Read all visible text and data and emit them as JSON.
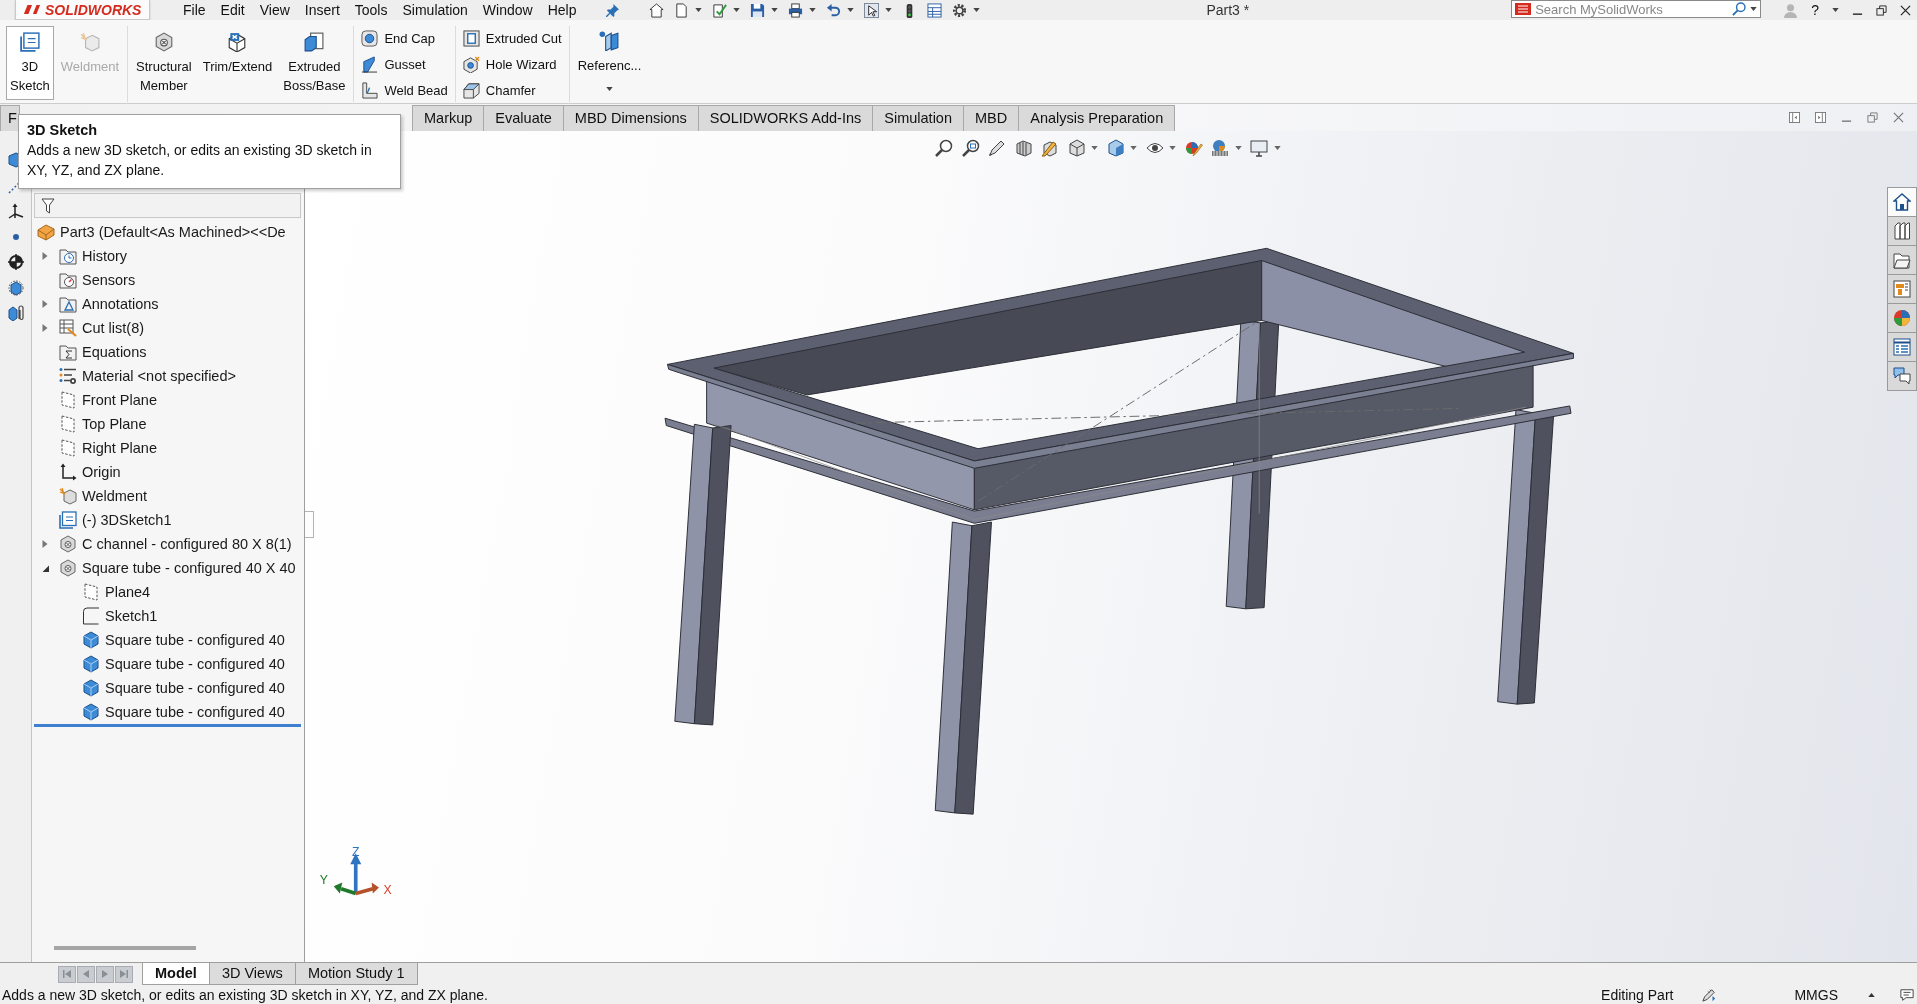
{
  "menu": {
    "logo": "SOLIDWORKS",
    "items": [
      "File",
      "Edit",
      "View",
      "Insert",
      "Tools",
      "Simulation",
      "Window",
      "Help"
    ],
    "help": "?"
  },
  "title": "Part3 *",
  "search": {
    "placeholder": "Search MySolidWorks"
  },
  "command_manager": {
    "large_groups": [
      [
        {
          "lines": [
            "3D",
            "Sketch"
          ],
          "kind": "sketch3d",
          "hovered": true,
          "disabled": false
        },
        {
          "lines": [
            "Weldment"
          ],
          "kind": "weldment",
          "hovered": false,
          "disabled": true
        }
      ],
      [
        {
          "lines": [
            "Structural",
            "Member"
          ],
          "kind": "member",
          "hovered": false,
          "disabled": false
        },
        {
          "lines": [
            "Trim/Extend"
          ],
          "kind": "trim",
          "hovered": false,
          "disabled": false
        },
        {
          "lines": [
            "Extruded",
            "Boss/Base"
          ],
          "kind": "boss",
          "hovered": false,
          "disabled": false
        }
      ]
    ],
    "small_groups": [
      [
        {
          "label": "End Cap",
          "kind": "endcap"
        },
        {
          "label": "Gusset",
          "kind": "gusset"
        },
        {
          "label": "Weld Bead",
          "kind": "weldbead"
        }
      ],
      [
        {
          "label": "Extruded Cut",
          "kind": "cut"
        },
        {
          "label": "Hole Wizard",
          "kind": "hole"
        },
        {
          "label": "Chamfer",
          "kind": "chamfer"
        }
      ]
    ],
    "reference": "Referenc..."
  },
  "tabs": [
    {
      "label": "F",
      "selected": false
    },
    {
      "label": "Markup",
      "selected": false
    },
    {
      "label": "Evaluate",
      "selected": false
    },
    {
      "label": "MBD Dimensions",
      "selected": false
    },
    {
      "label": "SOLIDWORKS Add-Ins",
      "selected": false
    },
    {
      "label": "Simulation",
      "selected": false
    },
    {
      "label": "MBD",
      "selected": false
    },
    {
      "label": "Analysis Preparation",
      "selected": false
    }
  ],
  "tooltip": {
    "title": "3D Sketch",
    "text": "Adds a new 3D sketch, or edits an existing 3D sketch in XY, YZ, and ZX plane."
  },
  "tree": {
    "root": {
      "label": "Part3 (Default<As Machined><<De",
      "kind": "part",
      "children": [
        {
          "label": "History",
          "kind": "history",
          "expanded": false
        },
        {
          "label": "Sensors",
          "kind": "sensors"
        },
        {
          "label": "Annotations",
          "kind": "annotations",
          "expanded": false
        },
        {
          "label": "Cut list(8)",
          "kind": "cutlist",
          "expanded": false
        },
        {
          "label": "Equations",
          "kind": "equations"
        },
        {
          "label": "Material <not specified>",
          "kind": "material"
        },
        {
          "label": "Front Plane",
          "kind": "plane"
        },
        {
          "label": "Top Plane",
          "kind": "plane"
        },
        {
          "label": "Right Plane",
          "kind": "plane"
        },
        {
          "label": "Origin",
          "kind": "origin"
        },
        {
          "label": "Weldment",
          "kind": "weldment"
        },
        {
          "label": "(-) 3DSketch1",
          "kind": "sketch3d"
        },
        {
          "label": "C channel - configured 80 X 8(1)",
          "kind": "member",
          "expanded": false
        },
        {
          "label": "Square tube - configured 40 X 40",
          "kind": "member",
          "expanded": true,
          "children": [
            {
              "label": "Plane4",
              "kind": "plane"
            },
            {
              "label": "Sketch1",
              "kind": "sketch"
            },
            {
              "label": "Square tube - configured 40",
              "kind": "body"
            },
            {
              "label": "Square tube - configured 40",
              "kind": "body"
            },
            {
              "label": "Square tube - configured 40",
              "kind": "body"
            },
            {
              "label": "Square tube - configured 40",
              "kind": "body"
            }
          ]
        }
      ]
    }
  },
  "triad": {
    "x": "X",
    "y": "Y",
    "z": "Z"
  },
  "task_pane": [
    {
      "kind": "home",
      "selected": true
    },
    {
      "kind": "library",
      "selected": false
    },
    {
      "kind": "folder",
      "selected": false
    },
    {
      "kind": "board",
      "selected": false
    },
    {
      "kind": "appearance",
      "selected": false
    },
    {
      "kind": "list",
      "selected": false
    },
    {
      "kind": "chat",
      "selected": false
    }
  ],
  "bottom_tabs": [
    {
      "label": "Model",
      "selected": true
    },
    {
      "label": "3D Views",
      "selected": false
    },
    {
      "label": "Motion Study 1",
      "selected": false
    }
  ],
  "status_bar": {
    "message": "Adds a new 3D sketch, or edits an existing 3D sketch in XY, YZ, and ZX plane.",
    "mode": "Editing Part",
    "units": "MMGS"
  }
}
